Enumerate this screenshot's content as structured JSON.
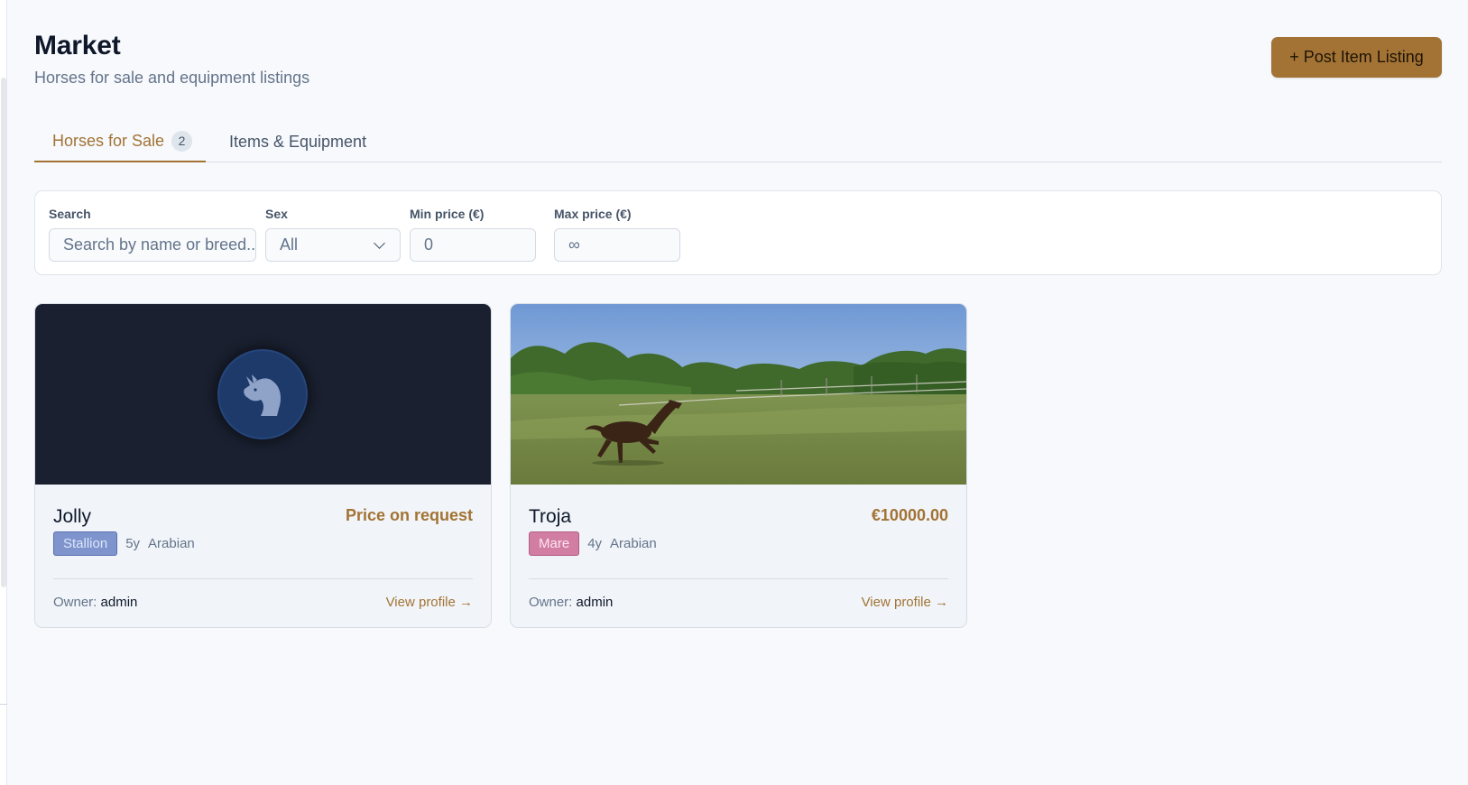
{
  "header": {
    "title": "Market",
    "subtitle": "Horses for sale and equipment listings",
    "post_button_label": "+ Post Item Listing"
  },
  "tabs": [
    {
      "label": "Horses for Sale",
      "count": "2",
      "active": true
    },
    {
      "label": "Items & Equipment",
      "active": false
    }
  ],
  "filters": {
    "search": {
      "label": "Search",
      "placeholder": "Search by name or breed...",
      "value": ""
    },
    "sex": {
      "label": "Sex",
      "selected": "All"
    },
    "min_price": {
      "label": "Min price (€)",
      "placeholder": "0"
    },
    "max_price": {
      "label": "Max price (€)",
      "placeholder": "∞"
    }
  },
  "listings": [
    {
      "name": "Jolly",
      "price": "Price on request",
      "sex": "Stallion",
      "age": "5y",
      "breed": "Arabian",
      "owner_label": "Owner:",
      "owner": "admin",
      "link": "View profile →",
      "image": "horse-head-placeholder-icon"
    },
    {
      "name": "Troja",
      "price": "€10000.00",
      "sex": "Mare",
      "age": "4y",
      "breed": "Arabian",
      "owner_label": "Owner:",
      "owner": "admin",
      "link": "View profile →",
      "image": "horse-photo"
    }
  ],
  "colors": {
    "accent": "#a27335",
    "stallion": "#7f94cc",
    "mare": "#d27ea2",
    "placeholder_bg": "#1a2030"
  }
}
